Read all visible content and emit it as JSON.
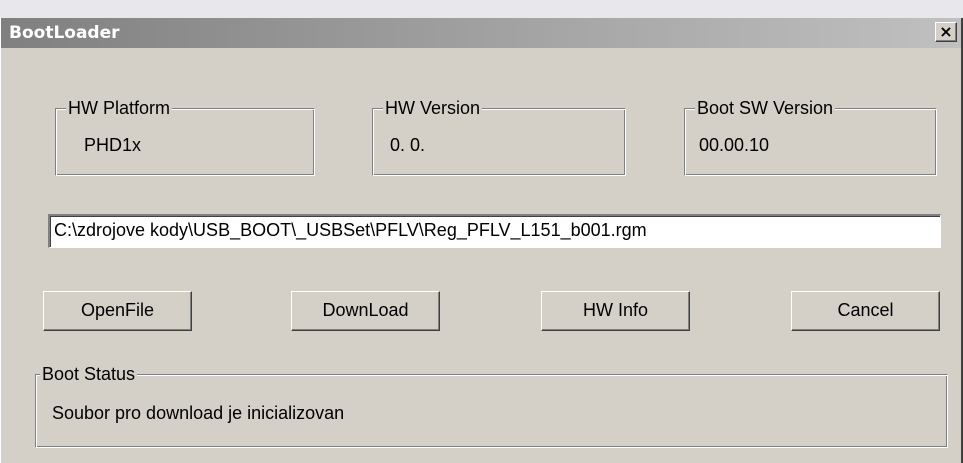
{
  "window": {
    "title": "BootLoader",
    "close_glyph": "×"
  },
  "hw_platform": {
    "label": "HW Platform",
    "value": "PHD1x"
  },
  "hw_version": {
    "label": "HW Version",
    "value": "0. 0."
  },
  "boot_sw_version": {
    "label": "Boot SW Version",
    "value": "00.00.10"
  },
  "file_path": {
    "value": "C:\\zdrojove kody\\USB_BOOT\\_USBSet\\PFLV\\Reg_PFLV_L151_b001.rgm"
  },
  "buttons": {
    "open_file": "OpenFile",
    "download": "DownLoad",
    "hw_info": "HW Info",
    "cancel": "Cancel"
  },
  "boot_status": {
    "label": "Boot Status",
    "message": "Soubor pro download je inicializovan"
  },
  "icons": {
    "close": "close-icon"
  }
}
